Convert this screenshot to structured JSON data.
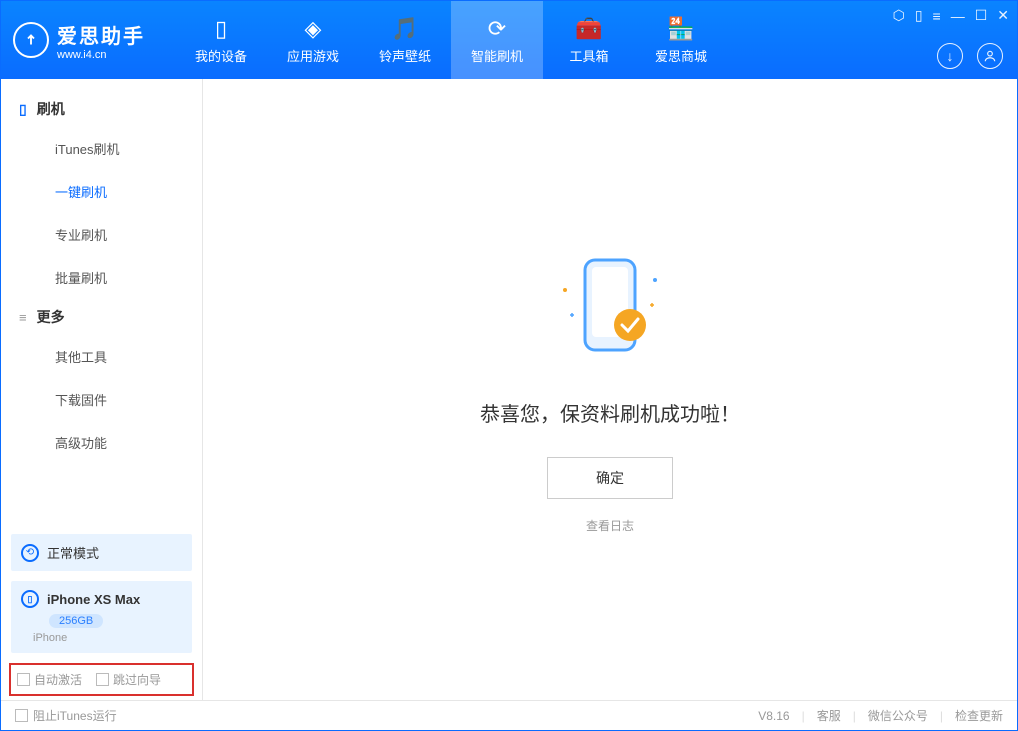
{
  "app": {
    "name": "爱思助手",
    "site": "www.i4.cn"
  },
  "navTabs": [
    {
      "label": "我的设备",
      "icon": "📱"
    },
    {
      "label": "应用游戏",
      "icon": "⬡"
    },
    {
      "label": "铃声壁纸",
      "icon": "♪"
    },
    {
      "label": "智能刷机",
      "icon": "⟳"
    },
    {
      "label": "工具箱",
      "icon": "🧰"
    },
    {
      "label": "爱思商城",
      "icon": "⌂"
    }
  ],
  "sidebar": {
    "section1": {
      "title": "刷机"
    },
    "items1": [
      {
        "label": "iTunes刷机"
      },
      {
        "label": "一键刷机"
      },
      {
        "label": "专业刷机"
      },
      {
        "label": "批量刷机"
      }
    ],
    "section2": {
      "title": "更多"
    },
    "items2": [
      {
        "label": "其他工具"
      },
      {
        "label": "下载固件"
      },
      {
        "label": "高级功能"
      }
    ],
    "mode": "正常模式",
    "device": {
      "name": "iPhone XS Max",
      "capacity": "256GB",
      "type": "iPhone"
    },
    "checks": {
      "autoActivate": "自动激活",
      "skipGuide": "跳过向导"
    }
  },
  "main": {
    "success": "恭喜您，保资料刷机成功啦！",
    "ok": "确定",
    "viewLog": "查看日志"
  },
  "footer": {
    "blockItunes": "阻止iTunes运行",
    "version": "V8.16",
    "links": {
      "service": "客服",
      "wechat": "微信公众号",
      "update": "检查更新"
    }
  }
}
